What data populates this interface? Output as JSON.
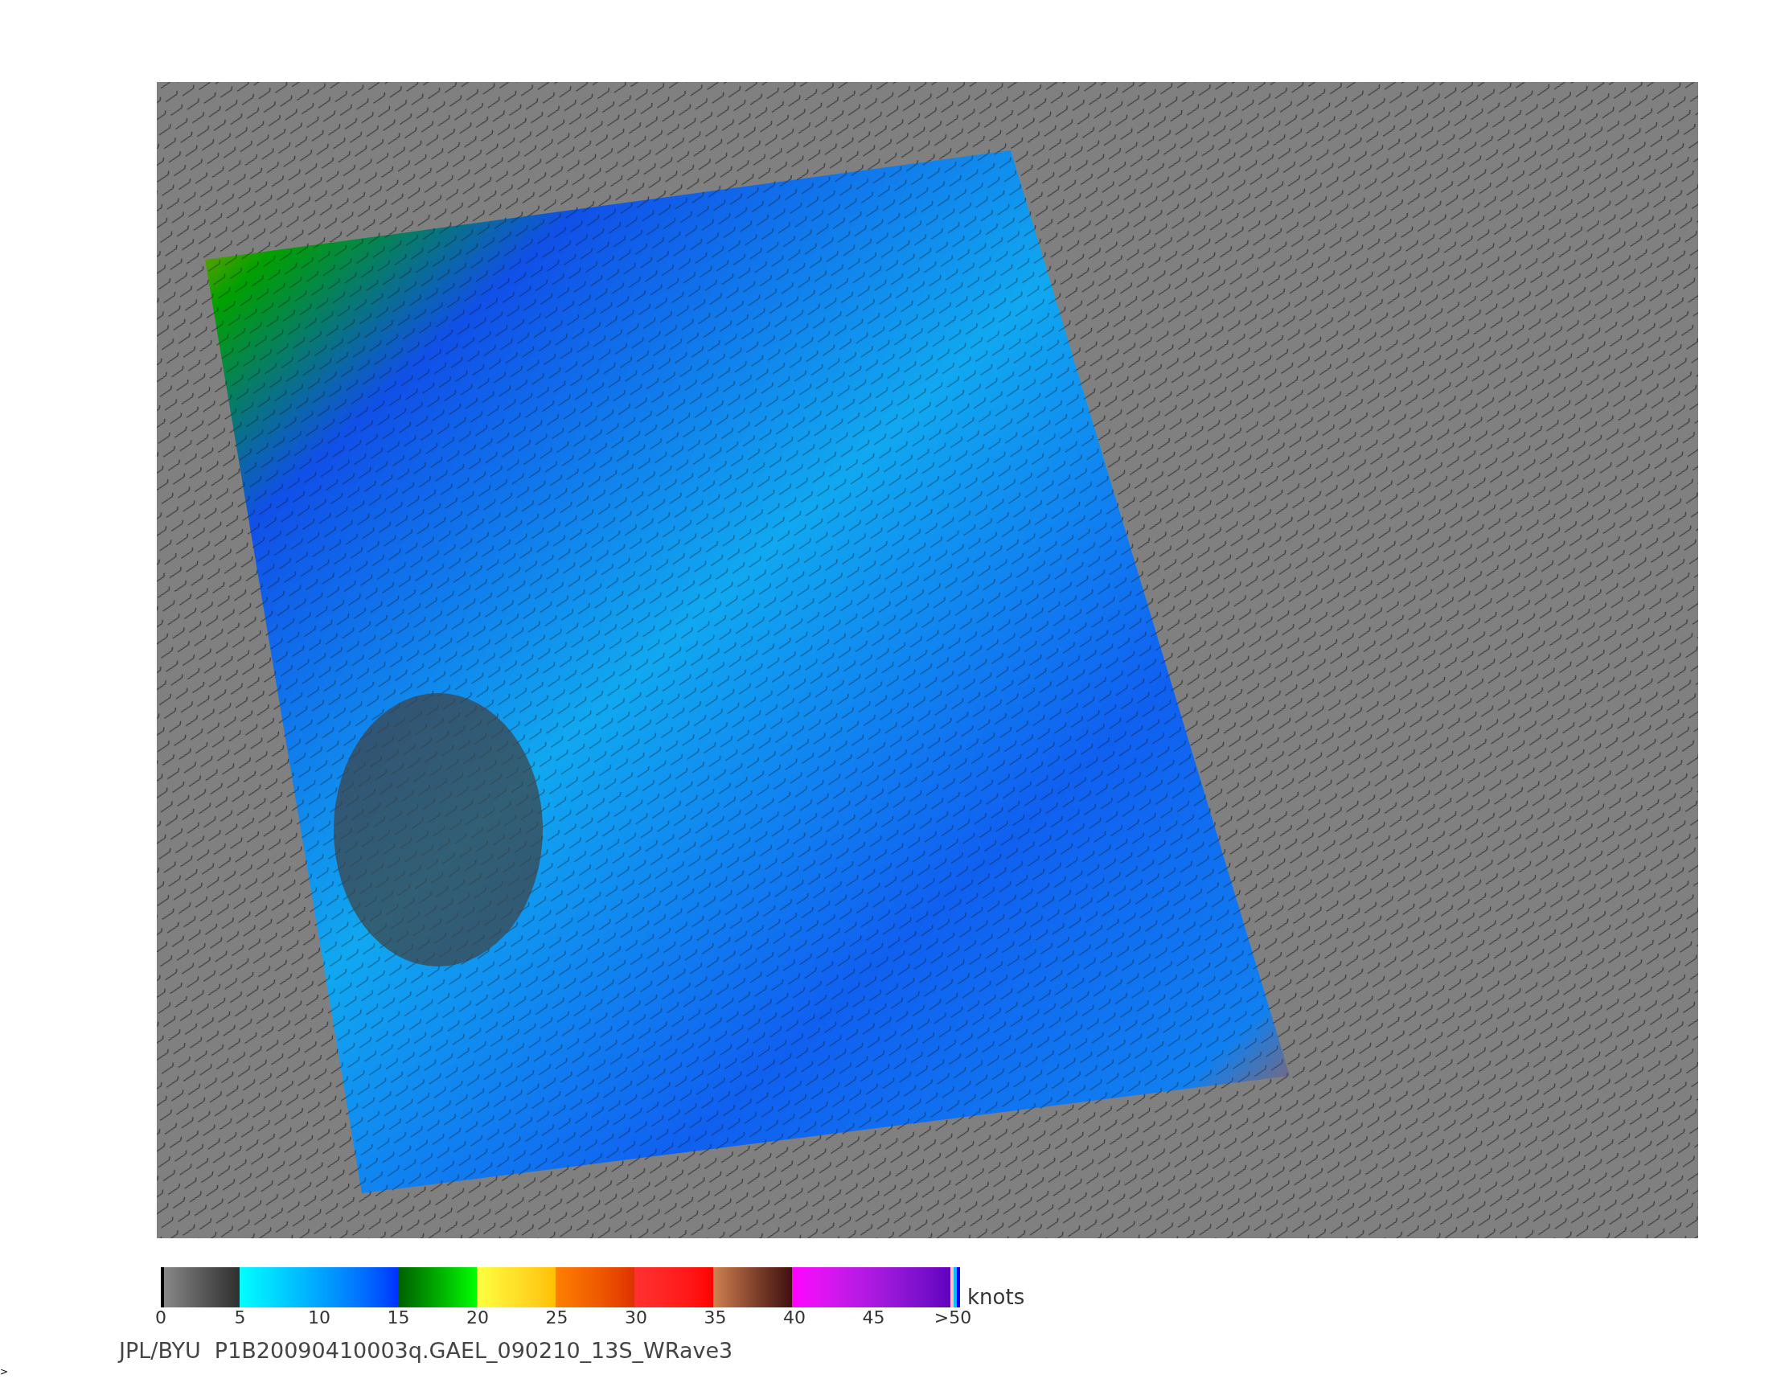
{
  "map": {
    "legend": {
      "ticks": [
        "0",
        "5",
        "10",
        "15",
        "20",
        "25",
        "30",
        "35",
        "40",
        "45",
        ">50"
      ],
      "unit": "knots"
    }
  },
  "caption": "JPL/BYU  P1B20090410003q.GAEL_090210_13S_WRave3",
  "corner_mark": ">"
}
